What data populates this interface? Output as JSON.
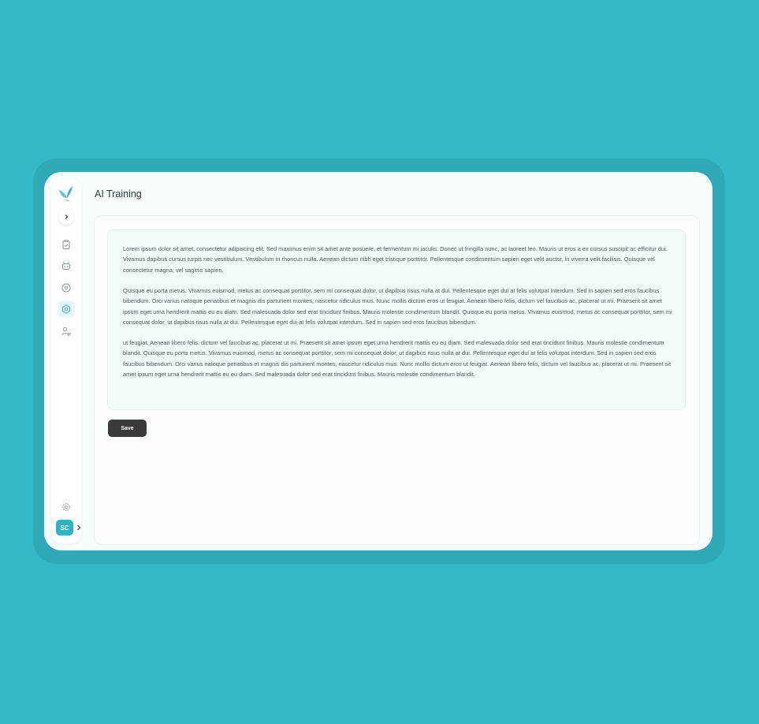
{
  "app": {
    "page_title": "AI Training"
  },
  "sidebar": {
    "items": [
      {
        "icon": "clipboard-icon"
      },
      {
        "icon": "bot-icon"
      },
      {
        "icon": "heart-chat-icon"
      },
      {
        "icon": "gear-network-icon",
        "active": true
      },
      {
        "icon": "user-settings-icon"
      }
    ],
    "footer_settings_icon": "settings-icon",
    "user_initials": "SC"
  },
  "training_text": {
    "paragraphs": [
      "Lorem ipsum dolor sit amet, consectetur adipiscing elit. Sed maximus enim sit amet ante posuere, et fermentum mi iaculis. Donec ut fringilla nunc, ac laoreet leo. Mauris ut eros a ex cursus suscipit ac efficitur dui. Vivamus dapibus cursus turpis nec vestibulum. Vestibulum in rhoncus nulla. Aenean dictum nibh eget tristique porttitor. Pellentesque condimentum sapien eget velit auctor, in viverra velit facilisis. Quisque vel consectetur magna, vel sagittis sapien.",
      "Quisque eu porta metus. Vivamus euismod, metus ac consequat porttitor, sem mi consequat dolor, ut dapibus risus nulla at dui. Pellentesque eget dui at felis volutpat interdum. Sed in sapien sed eros faucibus bibendum. Orci varius natoque penatibus et magnis dis parturient montes, nascetur ridiculus mus. Nunc mollis dictum eros ut feugiat. Aenean libero felis, dictum vel faucibus ac, placerat ut mi. Praesent sit amet ipsum eget urna hendrerit mattis eu eu diam. Sed malesuada dolor sed erat tincidunt finibus. Mauris molestie condimentum blandit. Quisque eu porta metus. Vivamus euismod, metus ac consequat porttitor, sem mi consequat dolor, ut dapibus risus nulla at dui. Pellentesque eget dui at felis volutpat interdum. Sed in sapien sed eros faucibus bibendum.",
      " ut feugiat. Aenean libero felis, dictum vel faucibus ac, placerat ut mi. Praesent sit amet ipsum eget urna hendrerit mattis eu eu diam. Sed malesuada dolor sed erat tincidunt finibus. Mauris molestie condimentum blandit. Quisque eu porta metus. Vivamus euismod, metus ac consequat porttitor, sem mi consequat dolor, ut dapibus risus nulla at dui. Pellentesque eget dui at felis volutpat interdum. Sed in sapien sed eros faucibus bibendum. Orci varius natoque penatibus et magnis dis parturient montes, nascetur ridiculus mus. Nunc mollis dictum eros ut feugiat. Aenean libero felis, dictum vel faucibus ac, placerat ut mi. Praesent sit amet ipsum eget urna hendrerit mattis eu eu diam. Sed malesuada dolor sed erat tincidunt finibus. Mauris molestie condimentum blandit."
    ]
  },
  "actions": {
    "save_label": "Save"
  },
  "colors": {
    "background": "#35b8c8",
    "accent": "#2db3c3",
    "save_button": "#3a3a3a"
  }
}
